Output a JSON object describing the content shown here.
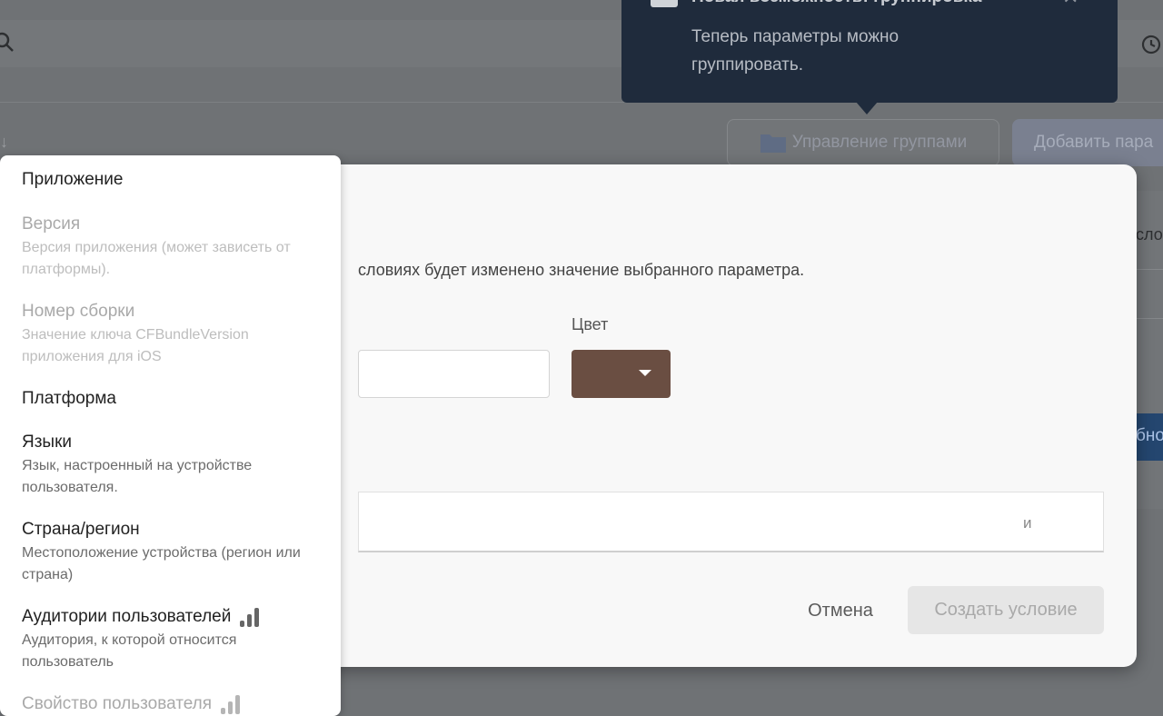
{
  "toast": {
    "title": "Новая возможность: группировка",
    "body": "Теперь параметры можно группировать."
  },
  "toolbar": {
    "manage_groups_label": "Управление группами",
    "add_parameter_label": "Добавить пара"
  },
  "background": {
    "right_text": "сло",
    "right_button": "бно"
  },
  "dialog": {
    "description": "словиях будет изменено значение выбранного параметра.",
    "color_label": "Цвет",
    "selected_color": "#6a4e42",
    "condition_connector": "и",
    "cancel_label": "Отмена",
    "create_label": "Создать условие"
  },
  "menu": {
    "items": [
      {
        "title": "Приложение",
        "subtitle": "",
        "disabled": false,
        "icon": ""
      },
      {
        "title": "Версия",
        "subtitle": "Версия приложения (может зависеть от платформы).",
        "disabled": true,
        "icon": ""
      },
      {
        "title": "Номер сборки",
        "subtitle": "Значение ключа CFBundleVersion приложения для iOS",
        "disabled": true,
        "icon": ""
      },
      {
        "title": "Платформа",
        "subtitle": "",
        "disabled": false,
        "icon": ""
      },
      {
        "title": "Языки",
        "subtitle": "Язык, настроенный на устройстве пользователя.",
        "disabled": false,
        "icon": ""
      },
      {
        "title": "Страна/регион",
        "subtitle": "Местоположение устройства (регион или страна)",
        "disabled": false,
        "icon": ""
      },
      {
        "title": "Аудитории пользователей",
        "subtitle": "Аудитория, к которой относится пользователь",
        "disabled": false,
        "icon": "analytics-bars-icon"
      },
      {
        "title": "Свойство пользователя",
        "subtitle": "",
        "disabled": true,
        "icon": "analytics-bars-icon"
      }
    ]
  }
}
